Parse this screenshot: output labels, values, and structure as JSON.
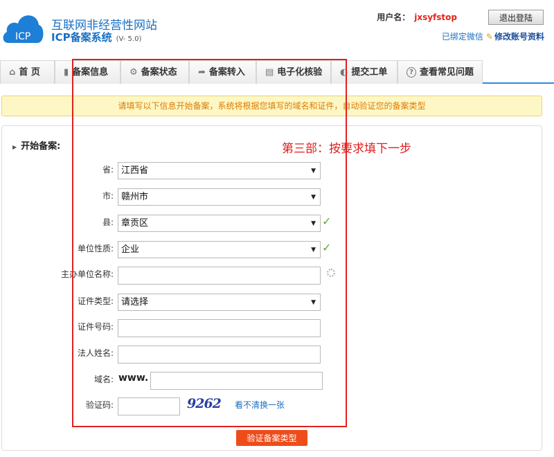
{
  "header": {
    "logo_text": "ICP",
    "title_line1": "互联网非经营性网站",
    "title_line2": "ICP备案系统",
    "version": "(V- 5.0)",
    "username_label": "用户名：",
    "username": "jxsyfstop",
    "logout_label": "退出登陆",
    "wechat_link": "已绑定微信",
    "edit_account_link": "修改账号资料"
  },
  "nav": {
    "tabs": [
      {
        "icon": "home-icon",
        "glyph": "⌂",
        "label": "首 页"
      },
      {
        "icon": "document-icon",
        "glyph": "▮",
        "label": "备案信息"
      },
      {
        "icon": "gear-icon",
        "glyph": "⚙",
        "label": "备案状态"
      },
      {
        "icon": "transfer-arrow-icon",
        "glyph": "➦",
        "label": "备案转入"
      },
      {
        "icon": "book-icon",
        "glyph": "▤",
        "label": "电子化核验"
      },
      {
        "icon": "ticket-icon",
        "glyph": "◐",
        "label": "提交工单"
      },
      {
        "icon": "question-icon",
        "glyph": "?",
        "label": "查看常见问题"
      }
    ]
  },
  "notice": "请填写以下信息开始备案，系统将根据您填写的域名和证件，自动验证您的备案类型",
  "form": {
    "section_title": "开始备案:",
    "annotation": "第三部：按要求填下一步",
    "province": {
      "label": "省:",
      "value": "江西省"
    },
    "city": {
      "label": "市:",
      "value": "赣州市"
    },
    "county": {
      "label": "县:",
      "value": "章贡区"
    },
    "unit_type": {
      "label": "单位性质:",
      "value": "企业"
    },
    "sponsor_name": {
      "label": "主办单位名称:",
      "value": ""
    },
    "cert_type": {
      "label": "证件类型:",
      "value": "请选择"
    },
    "cert_number": {
      "label": "证件号码:",
      "value": ""
    },
    "legal_name": {
      "label": "法人姓名:",
      "value": ""
    },
    "domain": {
      "label": "域名:",
      "prefix": "www.",
      "value": ""
    },
    "captcha": {
      "label": "验证码:",
      "image_text": "9262",
      "refresh_link": "看不清换一张"
    },
    "submit_label": "验证备案类型"
  },
  "colors": {
    "accent": "#1a6fc4",
    "annotation": "#e21b1b",
    "submit": "#ee4c1a",
    "notice_bg": "#fdf7c5"
  }
}
